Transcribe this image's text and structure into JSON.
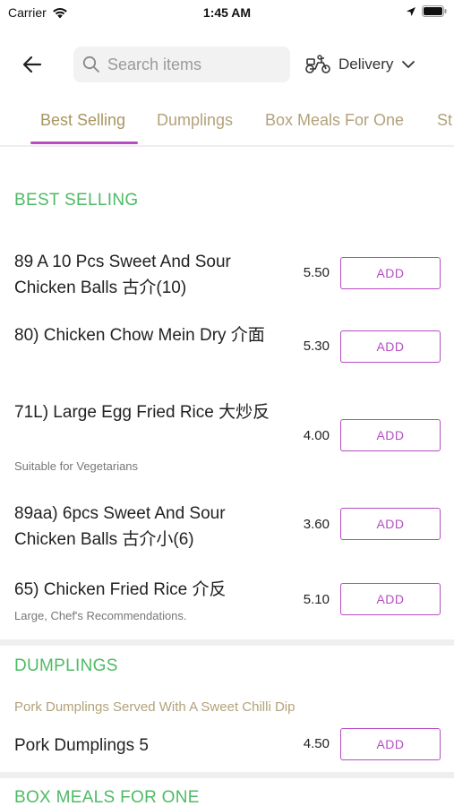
{
  "status_bar": {
    "carrier": "Carrier",
    "time": "1:45 AM"
  },
  "header": {
    "search_placeholder": "Search items",
    "delivery_label": "Delivery"
  },
  "tabs": [
    {
      "label": "Best Selling",
      "active": true
    },
    {
      "label": "Dumplings",
      "active": false
    },
    {
      "label": "Box Meals For One",
      "active": false
    },
    {
      "label": "St",
      "active": false
    }
  ],
  "best_selling": {
    "title": "BEST SELLING",
    "items": [
      {
        "name": "89 A 10 Pcs Sweet And Sour Chicken Balls 古介(10)",
        "note": "",
        "price": "5.50",
        "button": "ADD"
      },
      {
        "name": "80) Chicken Chow Mein Dry 介面",
        "note": "",
        "price": "5.30",
        "button": "ADD"
      },
      {
        "name": "71L) Large Egg Fried Rice  大炒反",
        "note": "Suitable for Vegetarians",
        "price": "4.00",
        "button": "ADD"
      },
      {
        "name": "89aa) 6pcs Sweet And Sour Chicken Balls 古介小(6)",
        "note": "",
        "price": "3.60",
        "button": "ADD"
      },
      {
        "name": "65) Chicken Fried Rice 介反",
        "note": "Large, Chef's Recommendations.",
        "price": "5.10",
        "button": "ADD"
      }
    ]
  },
  "dumplings": {
    "title": "DUMPLINGS",
    "description": "Pork Dumplings Served With A Sweet Chilli Dip",
    "items": [
      {
        "name": "Pork Dumplings 5",
        "price": "4.50",
        "button": "ADD"
      }
    ]
  },
  "box_meals": {
    "title": "BOX MEALS FOR ONE"
  },
  "colors": {
    "accent": "#b54cc3",
    "section_title": "#4dbb63",
    "tab_text": "#b3a27a"
  }
}
